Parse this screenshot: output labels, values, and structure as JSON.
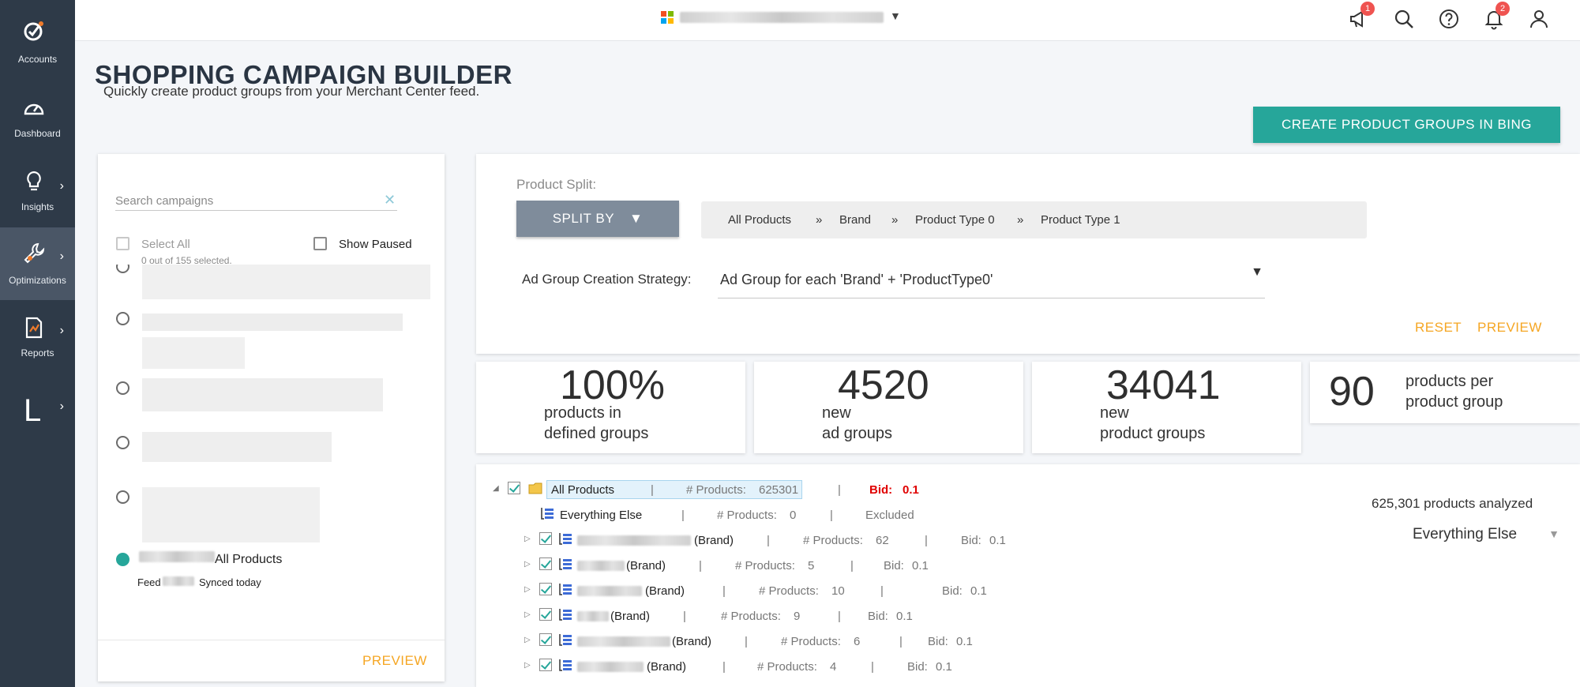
{
  "sidebar": {
    "items": [
      {
        "label": "Accounts",
        "icon": "accounts-icon"
      },
      {
        "label": "Dashboard",
        "icon": "dashboard-icon"
      },
      {
        "label": "Insights",
        "icon": "lightbulb-icon"
      },
      {
        "label": "Optimizations",
        "icon": "wrench-icon"
      },
      {
        "label": "Reports",
        "icon": "report-icon"
      },
      {
        "label": "L",
        "icon": "letter-l"
      }
    ]
  },
  "topbar": {
    "notifications_badge": "1",
    "alerts_badge": "2"
  },
  "header": {
    "title": "SHOPPING CAMPAIGN BUILDER",
    "subtitle": "Quickly create product groups from your Merchant Center feed.",
    "create_button": "CREATE PRODUCT GROUPS IN BING"
  },
  "left_panel": {
    "search_placeholder": "Search campaigns",
    "select_all": "Select All",
    "show_paused": "Show Paused",
    "selected_count": "0 out of 155 selected.",
    "selected_campaign_suffix": "All Products",
    "feed_prefix": "Feed",
    "feed_status": "Synced today",
    "preview": "PREVIEW"
  },
  "split": {
    "label": "Product Split:",
    "split_by": "SPLIT BY",
    "breadcrumb": [
      "All Products",
      "»",
      "Brand",
      "»",
      "Product Type 0",
      "»",
      "Product Type 1"
    ],
    "strategy_label": "Ad Group Creation Strategy:",
    "strategy_value": "Ad Group for each 'Brand' + 'ProductType0'",
    "reset": "RESET",
    "preview": "PREVIEW"
  },
  "stats": [
    {
      "value": "100%",
      "line1": "products in",
      "line2": "defined groups"
    },
    {
      "value": "4520",
      "line1": "new",
      "line2": "ad groups"
    },
    {
      "value": "34041",
      "line1": "new",
      "line2": "product groups"
    },
    {
      "value": "90",
      "line1": "products per",
      "line2": "product group"
    }
  ],
  "tree": {
    "analyzed": "625,301 products analyzed",
    "filter": "Everything Else",
    "sep": "|",
    "root": {
      "name": "All Products",
      "products_label": "# Products:",
      "products": "625301",
      "bid_label": "Bid:",
      "bid": "0.1"
    },
    "everything_else": {
      "name": "Everything Else",
      "products_label": "# Products:",
      "products": "0",
      "status": "Excluded"
    },
    "rows": [
      {
        "suffix": "(Brand)",
        "products_label": "# Products:",
        "products": "62",
        "bid_label": "Bid:",
        "bid": "0.1"
      },
      {
        "suffix": "(Brand)",
        "products_label": "# Products:",
        "products": "5",
        "bid_label": "Bid:",
        "bid": "0.1"
      },
      {
        "suffix": "(Brand)",
        "products_label": "# Products:",
        "products": "10",
        "bid_label": "Bid:",
        "bid": "0.1"
      },
      {
        "suffix": "(Brand)",
        "products_label": "# Products:",
        "products": "9",
        "bid_label": "Bid:",
        "bid": "0.1"
      },
      {
        "suffix": "(Brand)",
        "products_label": "# Products:",
        "products": "6",
        "bid_label": "Bid:",
        "bid": "0.1"
      },
      {
        "suffix": "(Brand)",
        "products_label": "# Products:",
        "products": "4",
        "bid_label": "Bid:",
        "bid": "0.1"
      }
    ]
  },
  "colors": {
    "accent": "#26a69a",
    "sidebar": "#2e3a48",
    "orange": "#f5a623",
    "bid_red": "#e00000"
  }
}
